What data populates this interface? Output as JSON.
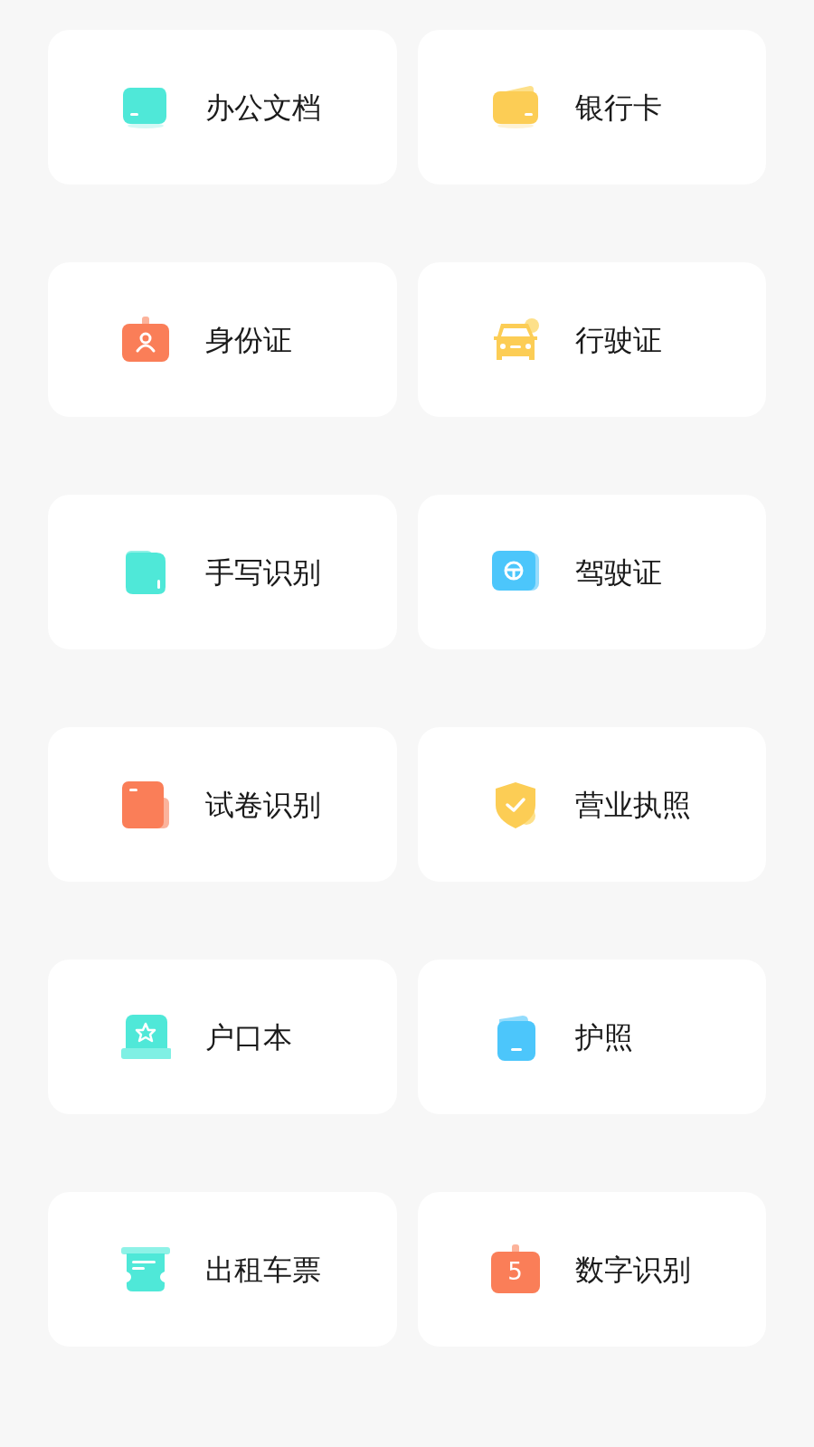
{
  "tiles": [
    {
      "label": "办公文档",
      "kind": "folder"
    },
    {
      "label": "银行卡",
      "kind": "wallet"
    },
    {
      "label": "身份证",
      "kind": "id-badge"
    },
    {
      "label": "行驶证",
      "kind": "car"
    },
    {
      "label": "手写识别",
      "kind": "handwriting"
    },
    {
      "label": "驾驶证",
      "kind": "steering"
    },
    {
      "label": "试卷识别",
      "kind": "paper"
    },
    {
      "label": "营业执照",
      "kind": "shield"
    },
    {
      "label": "户口本",
      "kind": "booklet"
    },
    {
      "label": "护照",
      "kind": "passport"
    },
    {
      "label": "出租车票",
      "kind": "ticket"
    },
    {
      "label": "数字识别",
      "kind": "digit",
      "badge": "5"
    }
  ]
}
